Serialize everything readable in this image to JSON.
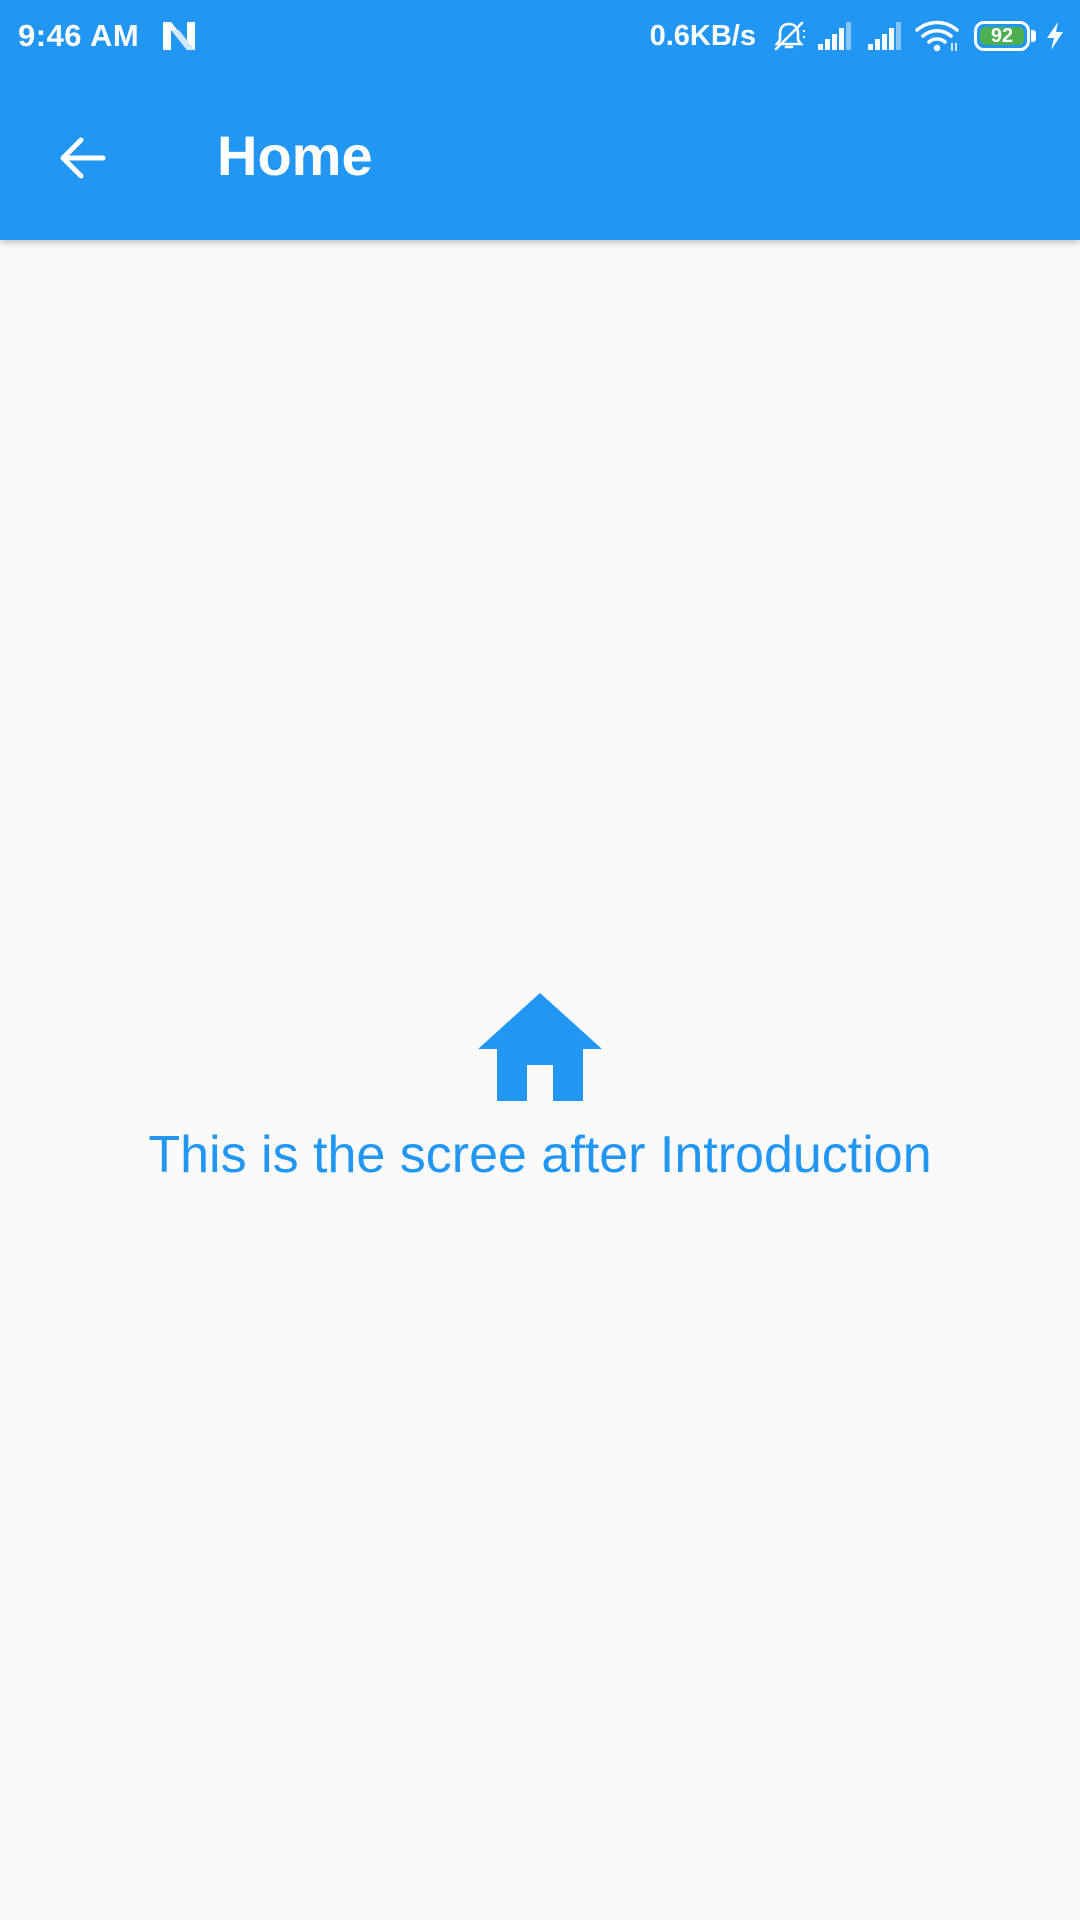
{
  "status_bar": {
    "time": "9:46 AM",
    "network_speed": "0.6KB/s",
    "battery_level": "92",
    "icons": [
      "n-notification-icon",
      "bell-off-icon",
      "signal-icon",
      "signal-icon",
      "wifi-icon",
      "battery-icon",
      "charging-bolt-icon"
    ]
  },
  "app_bar": {
    "title": "Home",
    "back_icon": "arrow-back-icon"
  },
  "body": {
    "icon": "home-icon",
    "message": "This is the scree after Introduction"
  },
  "colors": {
    "primary": "#2196f3",
    "background": "#fafafa",
    "battery_fill": "#4caf50"
  }
}
